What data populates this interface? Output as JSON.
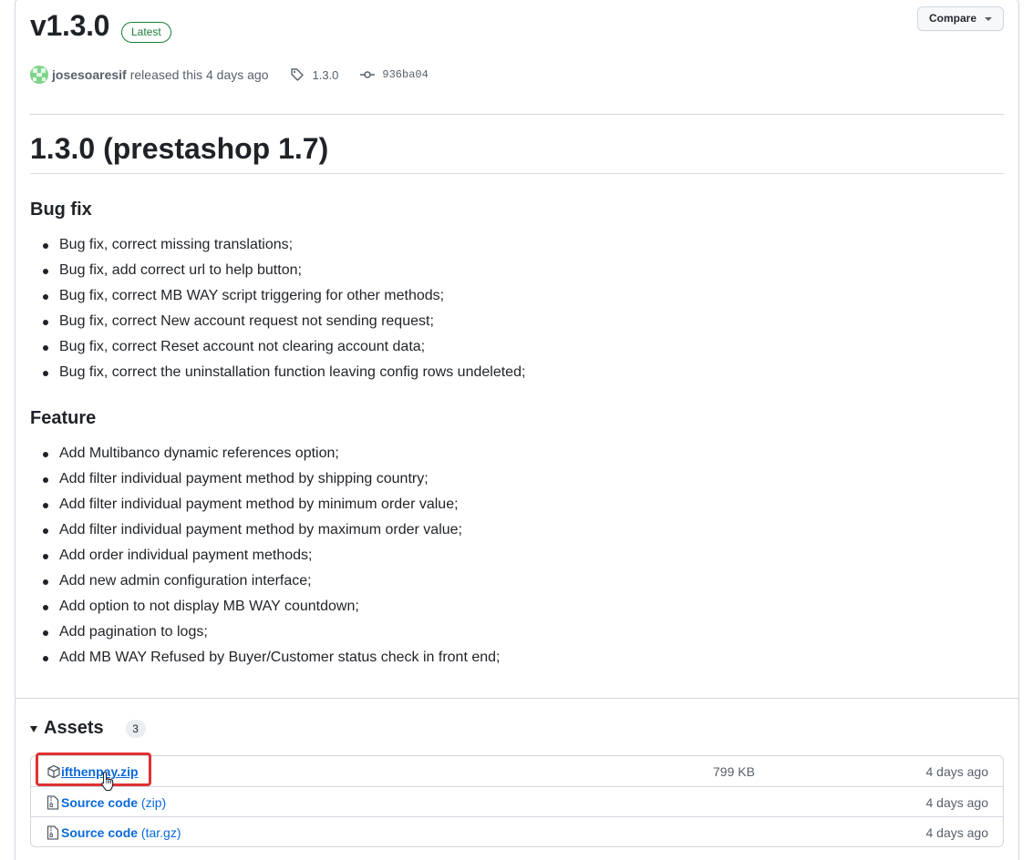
{
  "release": {
    "version": "v1.3.0",
    "latest_badge": "Latest",
    "compare_label": "Compare",
    "author": "josesoaresif",
    "released_text": "released this 4 days ago",
    "tag": "1.3.0",
    "commit": "936ba04"
  },
  "body": {
    "heading": "1.3.0 (prestashop 1.7)",
    "sections": [
      {
        "title": "Bug fix",
        "items": [
          "Bug fix, correct missing translations;",
          "Bug fix, add correct url to help button;",
          "Bug fix, correct MB WAY script triggering for other methods;",
          "Bug fix, correct New account request not sending request;",
          "Bug fix, correct Reset account not clearing account data;",
          "Bug fix, correct the uninstallation function leaving config rows undeleted;"
        ]
      },
      {
        "title": "Feature",
        "items": [
          "Add Multibanco dynamic references option;",
          "Add filter individual payment method by shipping country;",
          "Add filter individual payment method by minimum order value;",
          "Add filter individual payment method by maximum order value;",
          "Add order individual payment methods;",
          "Add new admin configuration interface;",
          "Add option to not display MB WAY countdown;",
          "Add pagination to logs;",
          "Add MB WAY Refused by Buyer/Customer status check in front end;"
        ]
      }
    ]
  },
  "assets": {
    "title": "Assets",
    "count": "3",
    "rows": [
      {
        "name": "ifthenpay.zip",
        "suffix": "",
        "size": "799 KB",
        "date": "4 days ago",
        "icon": "package-icon"
      },
      {
        "name": "Source code",
        "suffix": "(zip)",
        "size": "",
        "date": "4 days ago",
        "icon": "file-zip-icon"
      },
      {
        "name": "Source code",
        "suffix": "(tar.gz)",
        "size": "",
        "date": "4 days ago",
        "icon": "file-zip-icon"
      }
    ]
  },
  "colors": {
    "link": "#0969da",
    "latest_green": "#1a7f37",
    "highlight_red": "#e03131",
    "muted_text": "#57606a"
  }
}
